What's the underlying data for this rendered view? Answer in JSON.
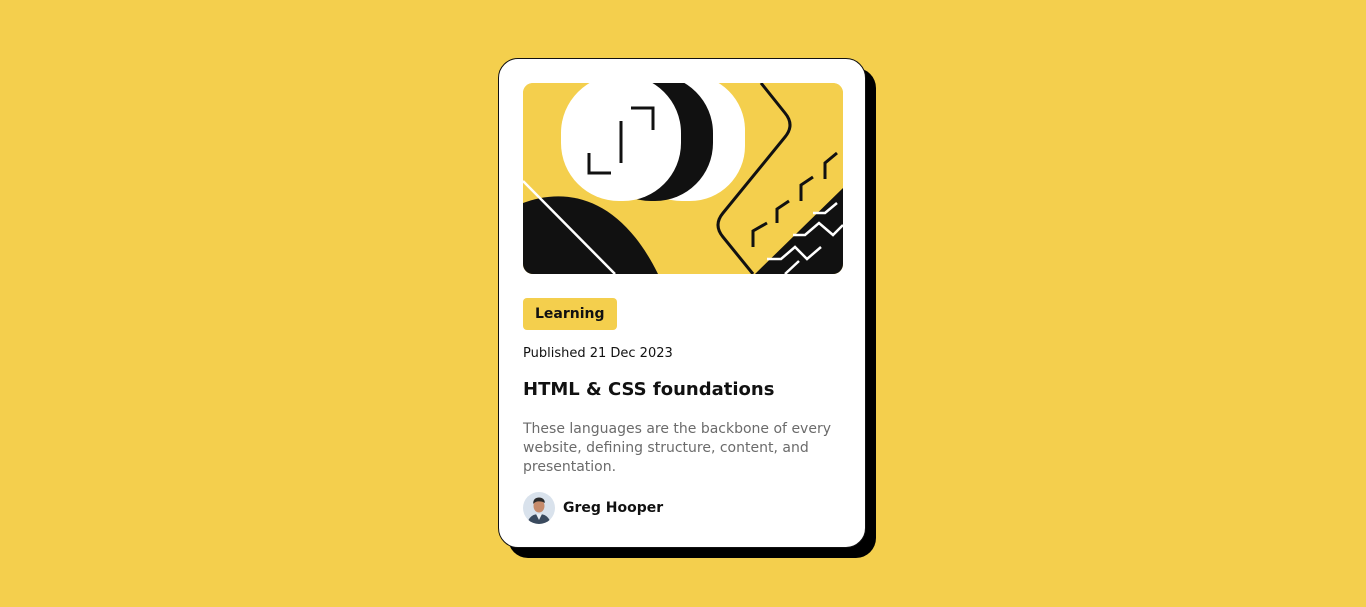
{
  "card": {
    "tag": "Learning",
    "published": "Published 21 Dec 2023",
    "title": "HTML & CSS foundations",
    "description": "These languages are the backbone of every website, defining structure, content, and presentation.",
    "author": {
      "name": "Greg Hooper",
      "avatar_icon": "person-avatar"
    },
    "illustration_icon": "abstract-code-illustration"
  },
  "colors": {
    "background": "#F4CF4D",
    "card": "#FFFFFF",
    "ink": "#111111",
    "muted_text": "#6B6B6B",
    "tag_background": "#F4CF4D"
  }
}
